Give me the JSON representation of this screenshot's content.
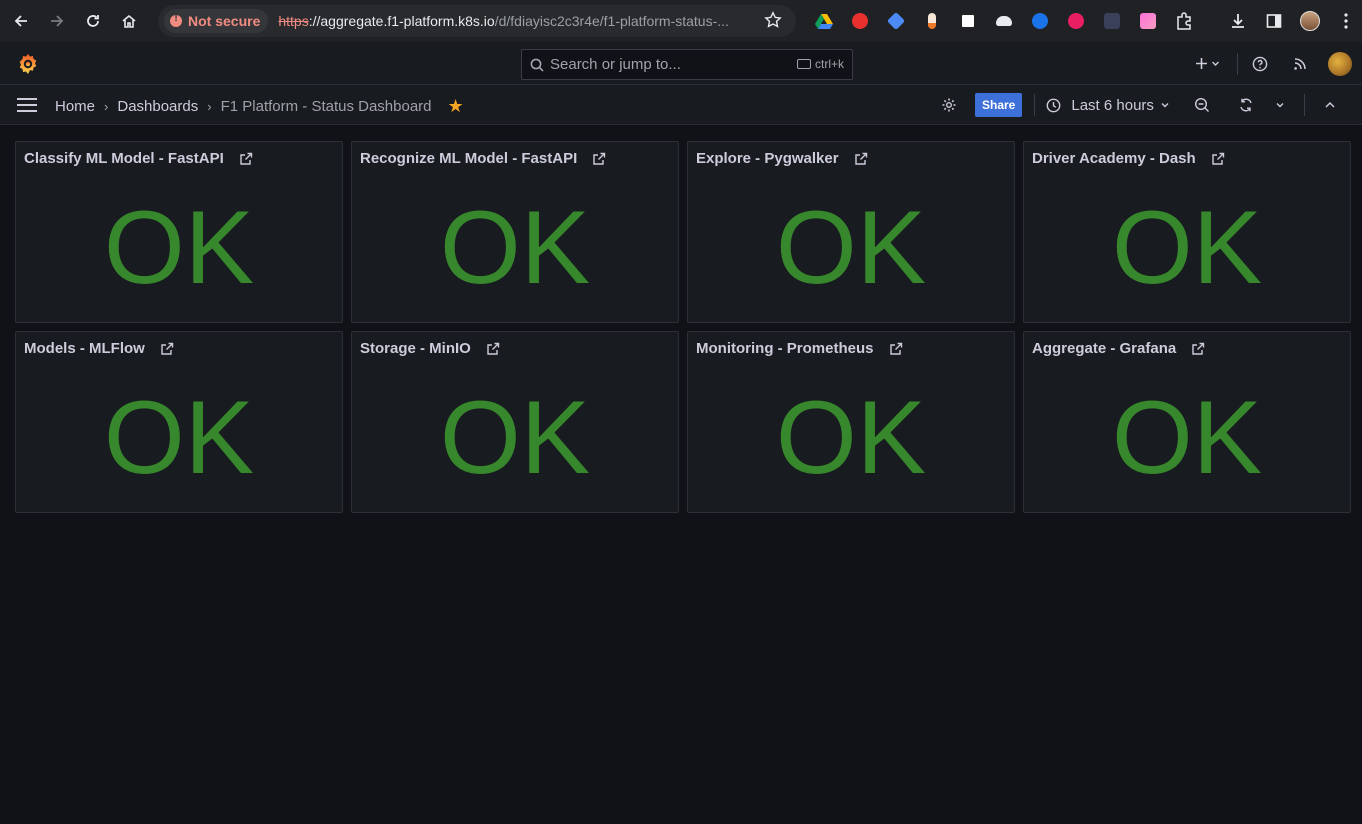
{
  "browser": {
    "security_label": "Not secure",
    "url_scheme": "https",
    "url_host": "://aggregate.f1-platform.k8s.io",
    "url_path": "/d/fdiayisc2c3r4e/f1-platform-status-..."
  },
  "topbar": {
    "search_placeholder": "Search or jump to...",
    "shortcut": "ctrl+k"
  },
  "breadcrumb": {
    "home": "Home",
    "dashboards": "Dashboards",
    "current": "F1 Platform - Status Dashboard"
  },
  "toolbar": {
    "share_label": "Share",
    "time_range": "Last 6 hours"
  },
  "colors": {
    "ok_green": "#37872d",
    "share_blue": "#3d71d9",
    "star": "#f5a524"
  },
  "panels": [
    {
      "title": "Classify ML Model - FastAPI",
      "value": "OK"
    },
    {
      "title": "Recognize ML Model - FastAPI",
      "value": "OK"
    },
    {
      "title": "Explore - Pygwalker",
      "value": "OK"
    },
    {
      "title": "Driver Academy - Dash",
      "value": "OK"
    },
    {
      "title": "Models - MLFlow",
      "value": "OK"
    },
    {
      "title": "Storage - MinIO",
      "value": "OK"
    },
    {
      "title": "Monitoring - Prometheus",
      "value": "OK"
    },
    {
      "title": "Aggregate - Grafana",
      "value": "OK"
    }
  ]
}
